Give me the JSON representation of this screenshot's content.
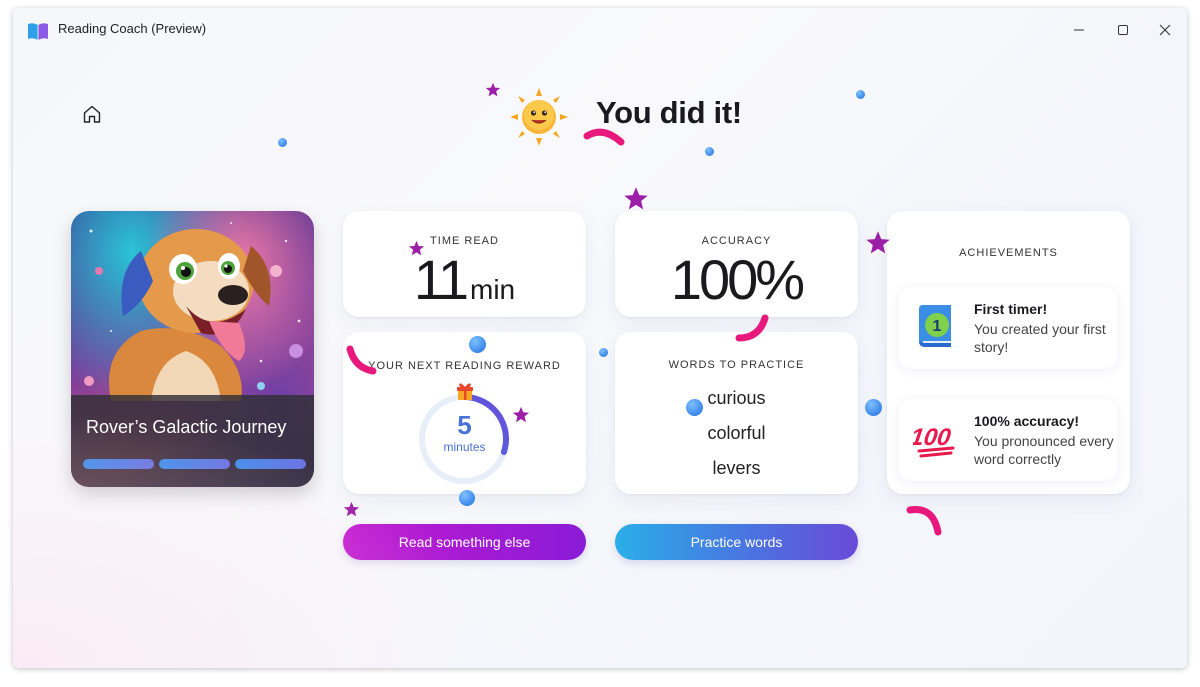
{
  "window": {
    "title": "Reading Coach (Preview)"
  },
  "colors": {
    "accent_purple": "#b01ad2",
    "accent_blue": "#3a8ee6",
    "confetti_pink": "#e8197c",
    "confetti_star": "#9c1fa8"
  },
  "header": {
    "headline": "You did it!",
    "mascot_icon": "sun-mascot-icon"
  },
  "book": {
    "title": "Rover’s Galactic Journey",
    "cover_icon": "dog-astronaut-illustration",
    "progress_segments_filled": 3,
    "progress_segments_total": 3
  },
  "stats": {
    "time_read": {
      "label": "TIME READ",
      "value": "11",
      "unit": "min"
    },
    "accuracy": {
      "label": "ACCURACY",
      "value": "100%"
    }
  },
  "reward": {
    "label": "YOUR NEXT READING REWARD",
    "value": "5",
    "unit": "minutes",
    "progress_fraction": 0.3,
    "icon": "gift-icon"
  },
  "words": {
    "label": "WORDS TO PRACTICE",
    "items": [
      "curious",
      "colorful",
      "levers"
    ]
  },
  "achievements": {
    "label": "ACHIEVEMENTS",
    "items": [
      {
        "title": "First timer!",
        "description": "You created your first story!",
        "icon": "book-number-one-icon"
      },
      {
        "title": "100% accuracy!",
        "description": "You pronounced every word correctly",
        "icon": "hundred-points-icon"
      }
    ]
  },
  "buttons": {
    "read_something_else": "Read something else",
    "practice_words": "Practice words"
  }
}
